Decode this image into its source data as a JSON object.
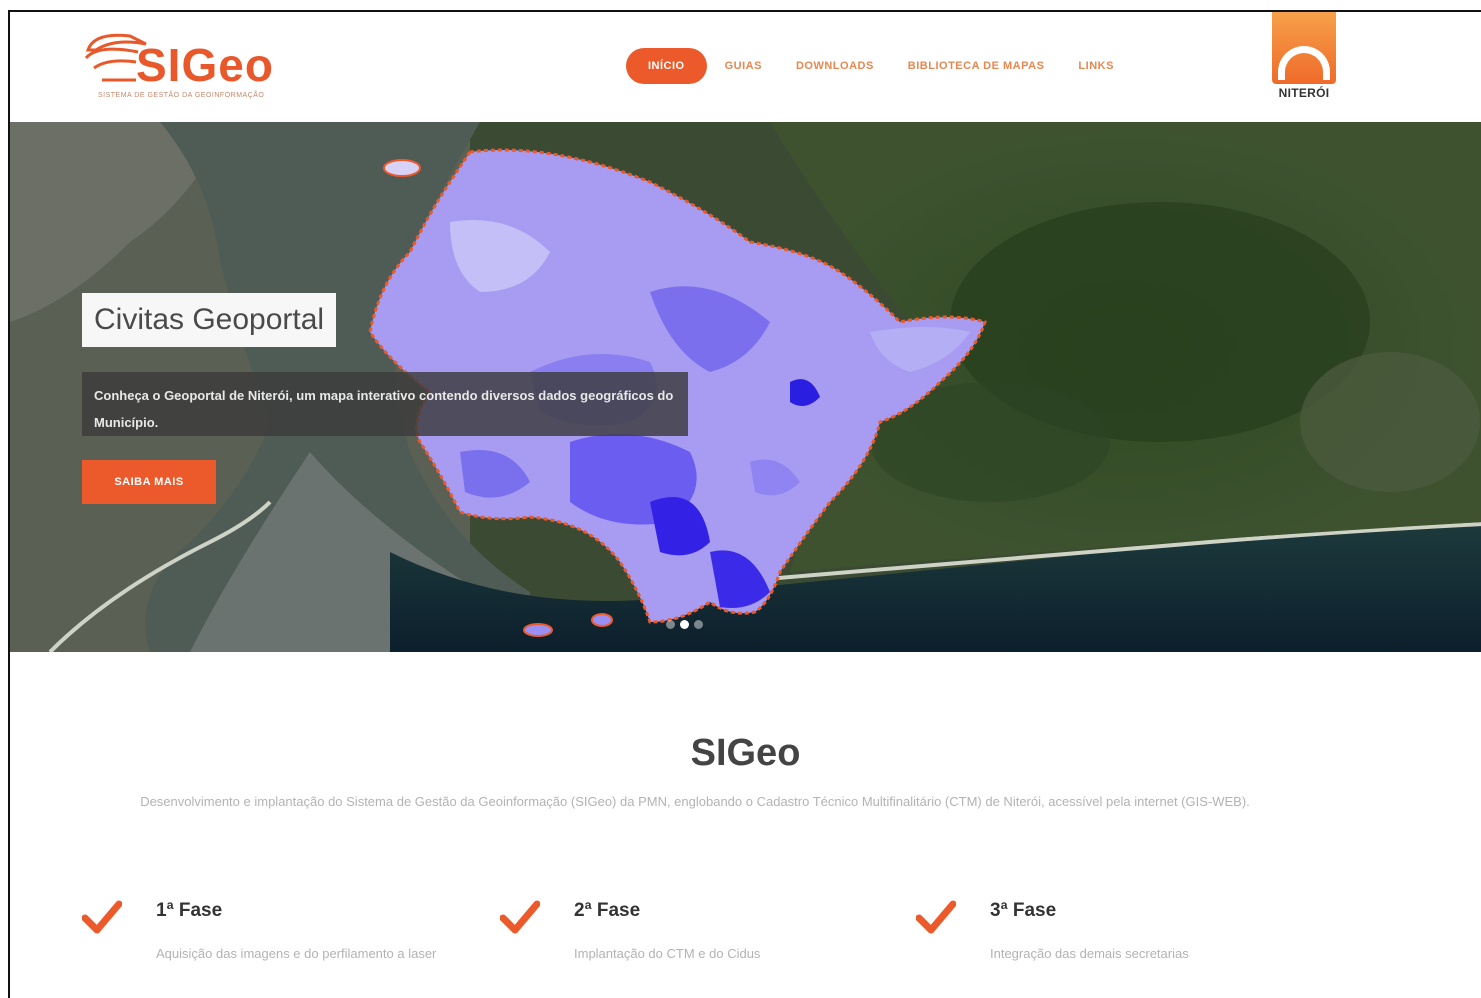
{
  "brand": {
    "logo_text": "SIGeo",
    "logo_subtitle": "SISTEMA DE GESTÃO DA GEOINFORMAÇÃO",
    "city_logo_label": "NITERÓI",
    "accent_color": "#ec5a2b"
  },
  "nav": {
    "items": [
      {
        "label": "INÍCIO",
        "active": true
      },
      {
        "label": "GUIAS",
        "active": false
      },
      {
        "label": "DOWNLOADS",
        "active": false
      },
      {
        "label": "BIBLIOTECA DE MAPAS",
        "active": false
      },
      {
        "label": "LINKS",
        "active": false
      }
    ]
  },
  "hero": {
    "title": "Civitas Geoportal",
    "description": "Conheça o Geoportal de Niterói, um mapa interativo contendo diversos dados geográficos do Município.",
    "button_label": "SAIBA MAIS",
    "slides": 3,
    "active_slide": 2
  },
  "intro": {
    "title": "SIGeo",
    "description": "Desenvolvimento e implantação do Sistema de Gestão da Geoinformação (SIGeo) da PMN, englobando o Cadastro Técnico Multifinalitário (CTM) de Niterói, acessível pela internet (GIS-WEB)."
  },
  "phases": [
    {
      "title": "1ª Fase",
      "text": "Aquisição das imagens e do perfilamento a laser"
    },
    {
      "title": "2ª Fase",
      "text": "Implantação do CTM e do Cidus"
    },
    {
      "title": "3ª Fase",
      "text": "Integração das demais secretarias"
    }
  ]
}
